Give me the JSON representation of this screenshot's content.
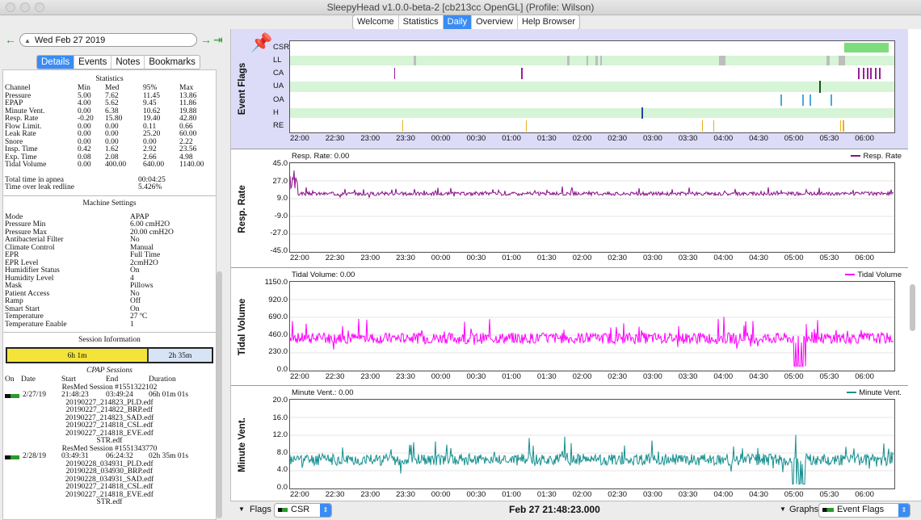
{
  "window": {
    "title": "SleepyHead v1.0.0-beta-2 [cb213cc OpenGL] (Profile: Wilson)"
  },
  "main_tabs": [
    "Welcome",
    "Statistics",
    "Daily",
    "Overview",
    "Help Browser"
  ],
  "active_tab": "Daily",
  "date_nav": {
    "date": "Wed Feb 27 2019"
  },
  "left_tabs": [
    "Details",
    "Events",
    "Notes",
    "Bookmarks"
  ],
  "statistics": {
    "heading": "Statistics",
    "columns": [
      "Channel",
      "Min",
      "Med",
      "95%",
      "Max"
    ],
    "rows": [
      [
        "Pressure",
        "5.00",
        "7.62",
        "11.45",
        "13.86"
      ],
      [
        "EPAP",
        "4.00",
        "5.62",
        "9.45",
        "11.86"
      ],
      [
        "Minute Vent.",
        "0.00",
        "6.38",
        "10.62",
        "19.88"
      ],
      [
        "Resp. Rate",
        "-0.20",
        "15.80",
        "19.40",
        "42.80"
      ],
      [
        "Flow Limit.",
        "0.00",
        "0.00",
        "0.11",
        "0.66"
      ],
      [
        "Leak Rate",
        "0.00",
        "0.00",
        "25.20",
        "60.00"
      ],
      [
        "Snore",
        "0.00",
        "0.00",
        "0.00",
        "2.22"
      ],
      [
        "Insp. Time",
        "0.42",
        "1.62",
        "2.92",
        "23.56"
      ],
      [
        "Exp. Time",
        "0.08",
        "2.08",
        "2.66",
        "4.98"
      ],
      [
        "Tidal Volume",
        "0.00",
        "400.00",
        "640.00",
        "1140.00"
      ]
    ],
    "apnea_label": "Total time in apnea",
    "apnea_value": "00:04:25",
    "leak_label": "Time over leak redline",
    "leak_value": "5.426%"
  },
  "machine_settings": {
    "heading": "Machine Settings",
    "items": [
      [
        "Mode",
        "APAP"
      ],
      [
        "Pressure Min",
        "6.00 cmH2O"
      ],
      [
        "Pressure Max",
        "20.00 cmH2O"
      ],
      [
        "Antibacterial Filter",
        "No"
      ],
      [
        "Climate Control",
        "Manual"
      ],
      [
        "EPR",
        "Full Time"
      ],
      [
        "EPR Level",
        "2cmH2O"
      ],
      [
        "Humidifier Status",
        "On"
      ],
      [
        "Humidity Level",
        "4"
      ],
      [
        "Mask",
        "Pillows"
      ],
      [
        "Patient Access",
        "No"
      ],
      [
        "Ramp",
        "Off"
      ],
      [
        "Smart Start",
        "On"
      ],
      [
        "Temperature",
        "27 ºC"
      ],
      [
        "Temperature Enable",
        "1"
      ]
    ]
  },
  "session_info": {
    "heading": "Session Information",
    "bar1": "6h 1m",
    "bar2": "2h 35m"
  },
  "cpap_sessions": {
    "heading": "CPAP Sessions",
    "columns": [
      "On",
      "Date",
      "Start",
      "End",
      "Duration"
    ],
    "sessions": [
      {
        "title": "ResMed Session #1551322102",
        "date": "2/27/19",
        "start": "21:48:23",
        "end": "03:49:24",
        "duration": "06h 01m 01s",
        "files": [
          "20190227_214823_PLD.edf",
          "20190227_214822_BRP.edf",
          "20190227_214823_SAD.edf",
          "20190227_214818_CSL.edf",
          "20190227_214818_EVE.edf",
          "STR.edf"
        ]
      },
      {
        "title": "ResMed Session #1551343770",
        "date": "2/28/19",
        "start": "03:49:31",
        "end": "06:24:32",
        "duration": "02h 35m 01s",
        "files": [
          "20190228_034931_PLD.edf",
          "20190228_034930_BRP.edf",
          "20190228_034931_SAD.edf",
          "20190227_214818_CSL.edf",
          "20190227_214818_EVE.edf",
          "STR.edf"
        ]
      }
    ]
  },
  "time_ticks": [
    "22:00",
    "22:30",
    "23:00",
    "23:30",
    "00:00",
    "00:30",
    "01:00",
    "01:30",
    "02:00",
    "02:30",
    "03:00",
    "03:30",
    "04:00",
    "04:30",
    "05:00",
    "05:30",
    "06:00"
  ],
  "event_flags": {
    "label": "Event Flags",
    "rows": [
      "CSR",
      "LL",
      "CA",
      "UA",
      "OA",
      "H",
      "RE"
    ],
    "colors": {
      "CSR": "#7ddd7d",
      "LL": "#bdbdbd",
      "CA": "#9a1f9a",
      "UA": "#1c4f1c",
      "OA": "#4aa8e0",
      "H": "#2244aa",
      "RE": "#e8b020"
    },
    "csr_band_color": "#d6f4d6",
    "events": {
      "CSR": [
        [
          0.917,
          0.99
        ]
      ],
      "LL": [
        [
          0.205,
          0.208
        ],
        [
          0.458,
          0.462
        ],
        [
          0.49,
          0.493
        ],
        [
          0.506,
          0.51
        ],
        [
          0.513,
          0.516
        ],
        [
          0.71,
          0.72
        ],
        [
          0.888,
          0.893
        ],
        [
          0.908,
          0.918
        ]
      ],
      "CA": [
        [
          0.172,
          0.173
        ],
        [
          0.383,
          0.384
        ],
        [
          0.94,
          0.942
        ],
        [
          0.948,
          0.95
        ],
        [
          0.955,
          0.957
        ],
        [
          0.96,
          0.962
        ],
        [
          0.968,
          0.97
        ],
        [
          0.975,
          0.977
        ]
      ],
      "UA": [
        [
          0.876,
          0.878
        ]
      ],
      "OA": [
        [
          0.812,
          0.814
        ],
        [
          0.848,
          0.85
        ],
        [
          0.86,
          0.862
        ],
        [
          0.895,
          0.897
        ]
      ],
      "H": [
        [
          0.582,
          0.584
        ]
      ],
      "RE": [
        [
          0.186,
          0.187
        ],
        [
          0.39,
          0.391
        ],
        [
          0.682,
          0.683
        ],
        [
          0.7,
          0.701
        ],
        [
          0.91,
          0.911
        ],
        [
          0.915,
          0.916
        ]
      ]
    }
  },
  "chart_data": [
    {
      "type": "line",
      "name_label": "Resp. Rate",
      "title": "Resp. Rate: 0.00",
      "series": [
        {
          "name": "Resp. Rate",
          "color": "#8a0f8a",
          "base": 14,
          "noise": 3,
          "seed": 3
        }
      ],
      "ylabel": "Resp. Rate",
      "yticks": [
        "45.0",
        "27.0",
        "9.0",
        "-9.0",
        "-27.0",
        "-45.0"
      ],
      "ylim": [
        -45,
        45
      ]
    },
    {
      "type": "line",
      "name_label": "Tidal Volume",
      "title": "Tidal Volume: 0.00",
      "series": [
        {
          "name": "Tidal Volume",
          "color": "#ff00ff",
          "base": 420,
          "noise": 120,
          "seed": 7
        }
      ],
      "ylabel": "Tidal Volume",
      "yticks": [
        "1150.0",
        "920.0",
        "690.0",
        "460.0",
        "230.0",
        "0.0"
      ],
      "ylim": [
        0,
        1150
      ]
    },
    {
      "type": "line",
      "name_label": "Minute Vent.",
      "title": "Minute Vent.: 0.00",
      "series": [
        {
          "name": "Minute Vent.",
          "color": "#168f8f",
          "base": 6.5,
          "noise": 2.2,
          "seed": 11
        }
      ],
      "ylabel": "Minute Vent.",
      "yticks": [
        "20.0",
        "16.0",
        "12.0",
        "8.0",
        "4.0",
        "0.0"
      ],
      "ylim": [
        0,
        20
      ]
    }
  ],
  "bottom_bar": {
    "flags_label": "Flags",
    "flags_select": "CSR",
    "timestamp": "Feb 27 21:48:23.000",
    "graphs_label": "Graphs",
    "graphs_select": "Event Flags"
  }
}
